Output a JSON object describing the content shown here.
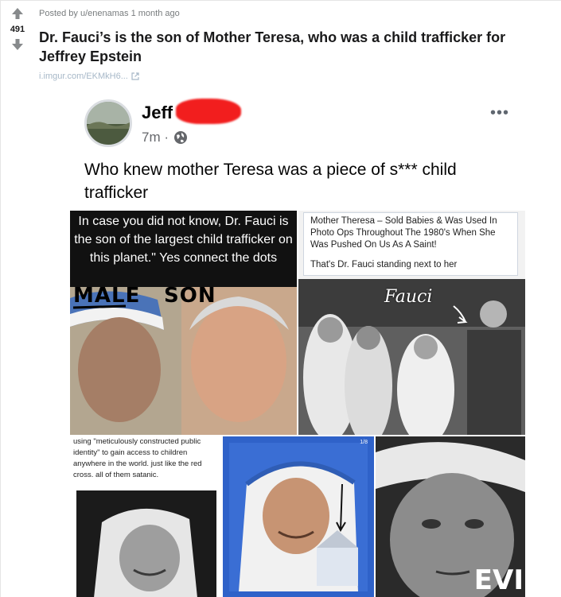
{
  "post": {
    "meta": "Posted by u/enenamas 1 month ago",
    "score": "491",
    "title": "Dr. Fauci’s is the son of Mother Teresa, who was a child trafficker for Jeffrey Epstein",
    "link_text": "i.imgur.com/EKMkH6...",
    "icons": [
      "upvote-arrow-icon",
      "downvote-arrow-icon",
      "external-link-icon"
    ]
  },
  "fb_post": {
    "name": "Jeff",
    "time": "7m ·",
    "more": "•••",
    "caption": "Who knew mother Teresa was a piece of s*** child trafficker",
    "icons": [
      "globe-icon",
      "more-options-icon"
    ],
    "redaction_color": "#f21e1e"
  },
  "collage": {
    "tile1": {
      "quote": "In case you did not know, Dr. Fauci is the son of the largest child trafficker on this planet.\" Yes connect the dots",
      "label_left": "MALE",
      "label_right": "SON"
    },
    "tile2": {
      "caption_1": "Mother Theresa – Sold Babies & Was Used In Photo Ops Throughout The 1980's When She Was Pushed On Us As A Saint!",
      "caption_2": "That's Dr. Fauci standing next to her",
      "scrawl": "Fauci"
    },
    "tile3": {
      "text": "using \"meticulously constructed public identity\" to gain access to children anywhere in the world. just like the red cross. all of them satanic."
    },
    "tile4": {
      "badge": "1/8"
    },
    "tile5": {
      "overlay": "EVI"
    }
  },
  "colors": {
    "link": "#a7b8c8",
    "meta": "#787c7e",
    "vote": "#878a8c",
    "tile4_bg": "#2f62c9"
  }
}
